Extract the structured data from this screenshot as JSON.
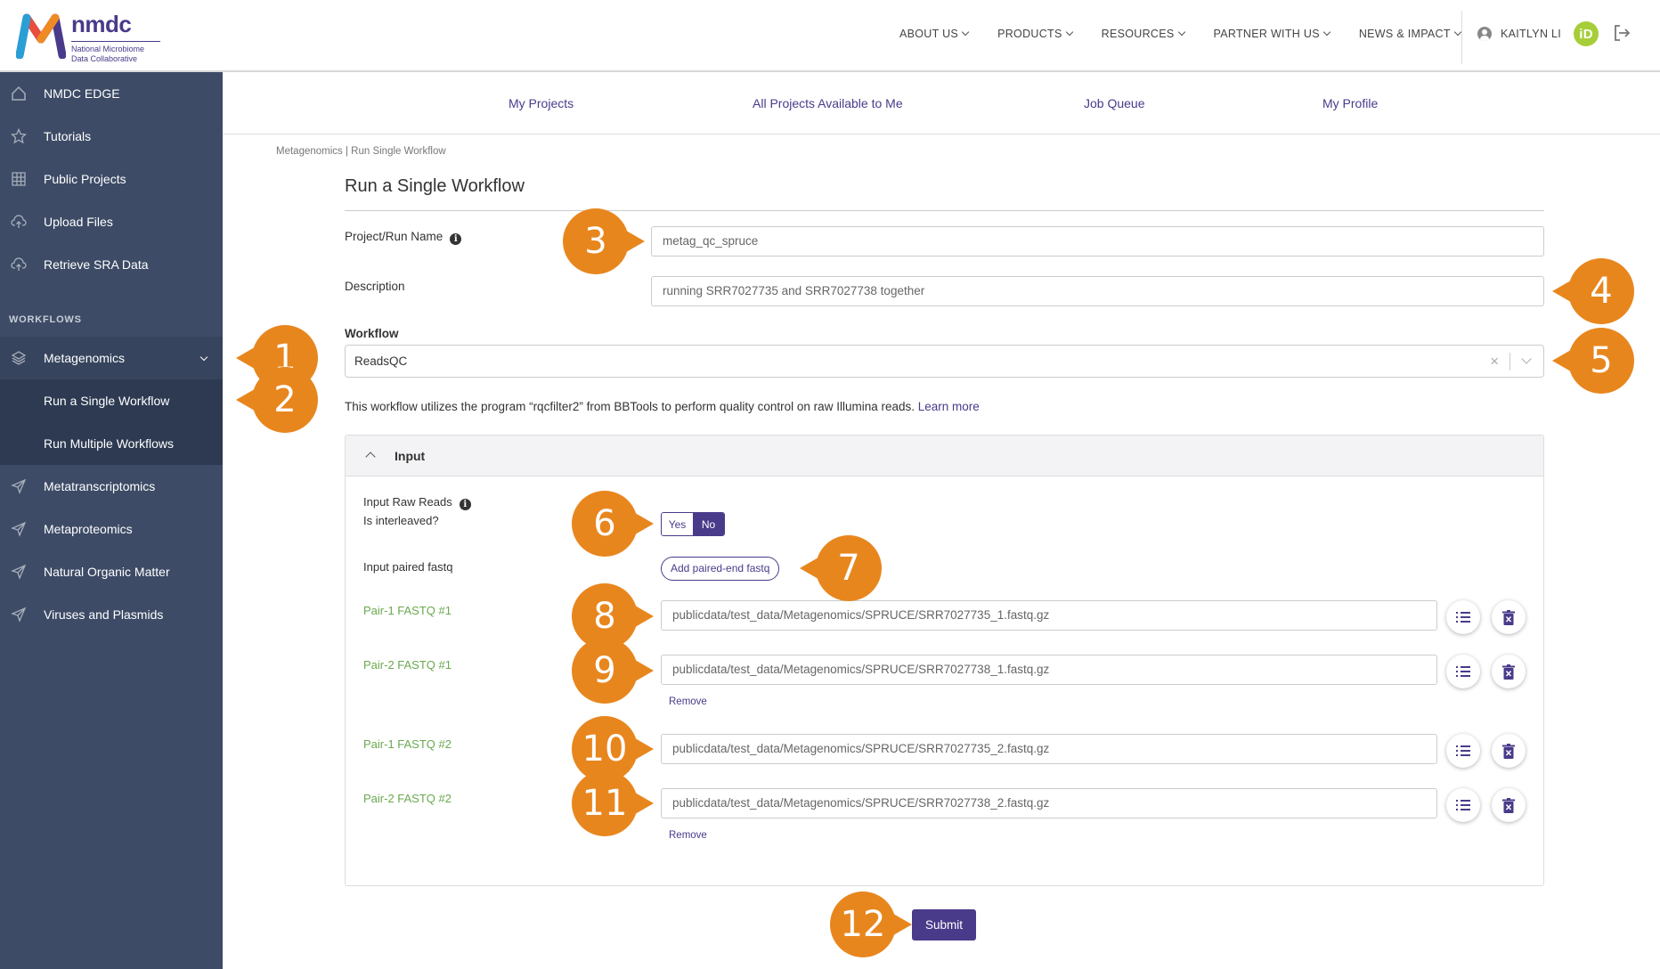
{
  "brand": {
    "name": "nmdc",
    "subtitle_line1": "National Microbiome",
    "subtitle_line2": "Data Collaborative",
    "colors": {
      "primary": "#4a3a8a",
      "sidebar": "#3d4b66",
      "callout": "#e8861e",
      "green_label": "#6aa84f",
      "orcid": "#a6ce39"
    }
  },
  "topnav": {
    "items": [
      {
        "label": "ABOUT US"
      },
      {
        "label": "PRODUCTS"
      },
      {
        "label": "RESOURCES"
      },
      {
        "label": "PARTNER WITH US"
      },
      {
        "label": "NEWS & IMPACT"
      }
    ],
    "user_name": "KAITLYN LI",
    "orcid_label": "iD"
  },
  "sidebar": {
    "items": [
      {
        "label": "NMDC EDGE",
        "icon": "home-icon"
      },
      {
        "label": "Tutorials",
        "icon": "star-icon"
      },
      {
        "label": "Public Projects",
        "icon": "grid-icon"
      },
      {
        "label": "Upload Files",
        "icon": "cloud-upload-icon"
      },
      {
        "label": "Retrieve SRA Data",
        "icon": "cloud-upload-icon"
      }
    ],
    "section_label": "WORKFLOWS",
    "workflows": [
      {
        "label": "Metagenomics",
        "icon": "layers-icon"
      },
      {
        "label": "Run a Single Workflow"
      },
      {
        "label": "Run Multiple Workflows"
      },
      {
        "label": "Metatranscriptomics",
        "icon": "send-icon"
      },
      {
        "label": "Metaproteomics",
        "icon": "send-icon"
      },
      {
        "label": "Natural Organic Matter",
        "icon": "send-icon"
      },
      {
        "label": "Viruses and Plasmids",
        "icon": "send-icon"
      }
    ]
  },
  "subnav": {
    "items": [
      {
        "label": "My Projects"
      },
      {
        "label": "All Projects Available to Me"
      },
      {
        "label": "Job Queue"
      },
      {
        "label": "My Profile"
      }
    ]
  },
  "page": {
    "breadcrumb": "Metagenomics | Run Single Workflow",
    "title": "Run a Single Workflow"
  },
  "form": {
    "project_label": "Project/Run Name",
    "project_value": "metag_qc_spruce",
    "description_label": "Description",
    "description_value": "running SRR7027735 and SRR7027738 together",
    "workflow_label": "Workflow",
    "workflow_value": "ReadsQC",
    "workflow_desc": "This workflow utilizes the program “rqcfilter2” from BBTools to perform quality control on raw Illumina reads.",
    "learn_more": "Learn more"
  },
  "input_card": {
    "title": "Input",
    "interleaved_label_1": "Input Raw Reads",
    "interleaved_label_2": "Is interleaved?",
    "yes": "Yes",
    "no": "No",
    "paired_label": "Input paired fastq",
    "add_paired": "Add paired-end fastq",
    "fastq": [
      {
        "label": "Pair-1 FASTQ #1",
        "value": "publicdata/test_data/Metagenomics/SPRUCE/SRR7027735_1.fastq.gz"
      },
      {
        "label": "Pair-2 FASTQ #1",
        "value": "publicdata/test_data/Metagenomics/SPRUCE/SRR7027738_1.fastq.gz"
      },
      {
        "label": "Pair-1 FASTQ #2",
        "value": "publicdata/test_data/Metagenomics/SPRUCE/SRR7027735_2.fastq.gz"
      },
      {
        "label": "Pair-2 FASTQ #2",
        "value": "publicdata/test_data/Metagenomics/SPRUCE/SRR7027738_2.fastq.gz"
      }
    ],
    "remove": "Remove"
  },
  "submit_label": "Submit",
  "callouts": [
    "1",
    "2",
    "3",
    "4",
    "5",
    "6",
    "7",
    "8",
    "9",
    "10",
    "11",
    "12"
  ]
}
